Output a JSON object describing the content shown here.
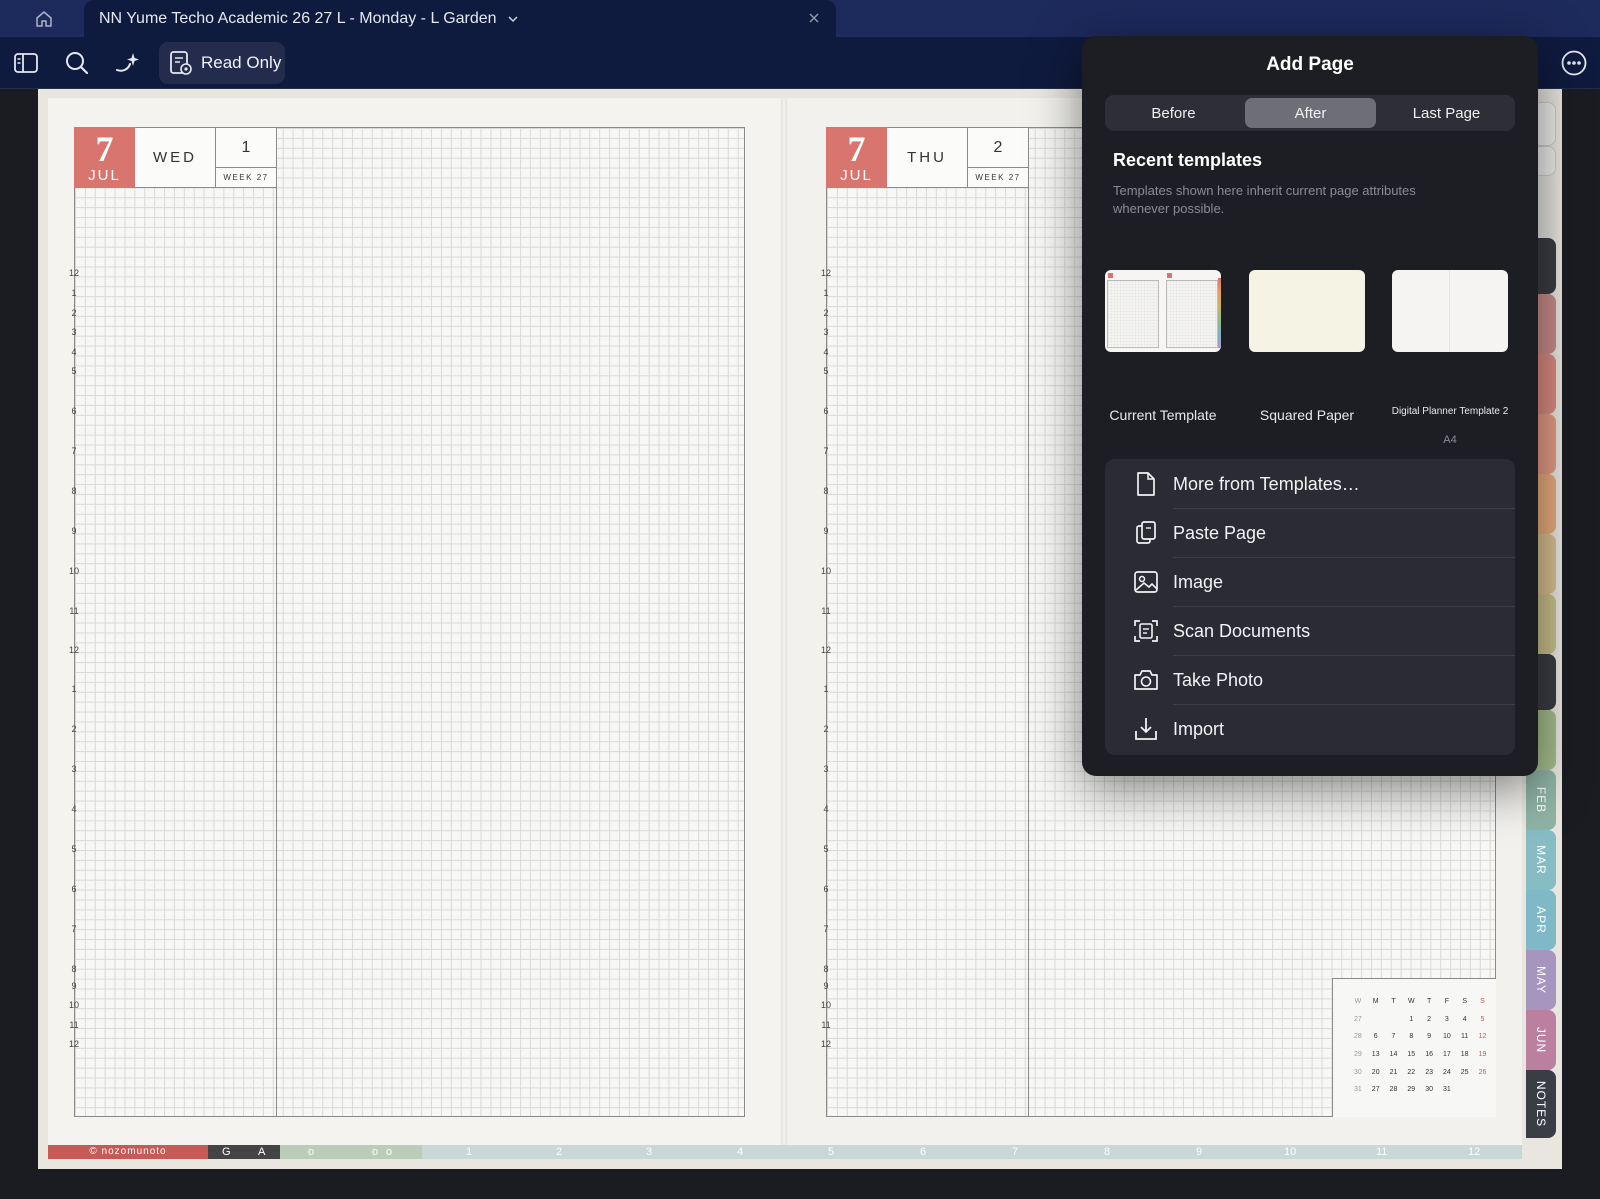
{
  "tab": {
    "title": "NN Yume Techo Academic 26 27 L - Monday - L Garden"
  },
  "toolbar": {
    "read_only_label": "Read Only"
  },
  "left_page": {
    "date_number": "7",
    "month": "JUL",
    "weekday": "WED",
    "week_number": "1",
    "week_label": "WEEK 27"
  },
  "right_page": {
    "date_number": "7",
    "month": "JUL",
    "weekday": "THU",
    "week_number": "2",
    "week_label": "WEEK 27"
  },
  "hour_labels": [
    "12",
    "1",
    "2",
    "3",
    "4",
    "5",
    "6",
    "7",
    "8",
    "9",
    "10",
    "11",
    "12",
    "1",
    "2",
    "3",
    "4",
    "5",
    "6",
    "7",
    "8",
    "9",
    "10",
    "11",
    "12"
  ],
  "mini_calendar": {
    "headers": [
      "W",
      "M",
      "T",
      "W",
      "T",
      "F",
      "S",
      "S"
    ],
    "rows": [
      [
        "27",
        "",
        "",
        "1",
        "2",
        "3",
        "4",
        "5"
      ],
      [
        "28",
        "6",
        "7",
        "8",
        "9",
        "10",
        "11",
        "12"
      ],
      [
        "29",
        "13",
        "14",
        "15",
        "16",
        "17",
        "18",
        "19"
      ],
      [
        "30",
        "20",
        "21",
        "22",
        "23",
        "24",
        "25",
        "26"
      ],
      [
        "31",
        "27",
        "28",
        "29",
        "30",
        "31",
        "",
        ""
      ]
    ]
  },
  "bottom_strip": {
    "brand": "© nozomunoto",
    "letters": [
      "G",
      "A"
    ],
    "circles": [
      "o",
      "o",
      "o"
    ],
    "months": [
      "1",
      "2",
      "3",
      "4",
      "5",
      "6",
      "7",
      "8",
      "9",
      "10",
      "11",
      "12"
    ]
  },
  "side_tabs": [
    {
      "label": "FEB",
      "color": "#8fb3a6"
    },
    {
      "label": "MAR",
      "color": "#86bcc3"
    },
    {
      "label": "APR",
      "color": "#7fb9c8"
    },
    {
      "label": "MAY",
      "color": "#a595bf"
    },
    {
      "label": "JUN",
      "color": "#bb7fa0"
    },
    {
      "label": "NOTES",
      "color": "#3b3d44"
    }
  ],
  "popover": {
    "title": "Add Page",
    "segments": [
      "Before",
      "After",
      "Last Page"
    ],
    "active_segment": "After",
    "recent_title": "Recent templates",
    "recent_desc": "Templates shown here inherit current page attributes whenever possible.",
    "templates": [
      {
        "name": "Current Template",
        "sub": ""
      },
      {
        "name": "Squared Paper",
        "sub": ""
      },
      {
        "name": "Digital Planner Template 2",
        "sub": "A4"
      }
    ],
    "menu": [
      {
        "label": "More from Templates…",
        "icon": "document-icon"
      },
      {
        "label": "Paste Page",
        "icon": "paste-icon"
      },
      {
        "label": "Image",
        "icon": "image-icon"
      },
      {
        "label": "Scan Documents",
        "icon": "scan-icon"
      },
      {
        "label": "Take Photo",
        "icon": "camera-icon"
      },
      {
        "label": "Import",
        "icon": "import-icon"
      }
    ]
  }
}
